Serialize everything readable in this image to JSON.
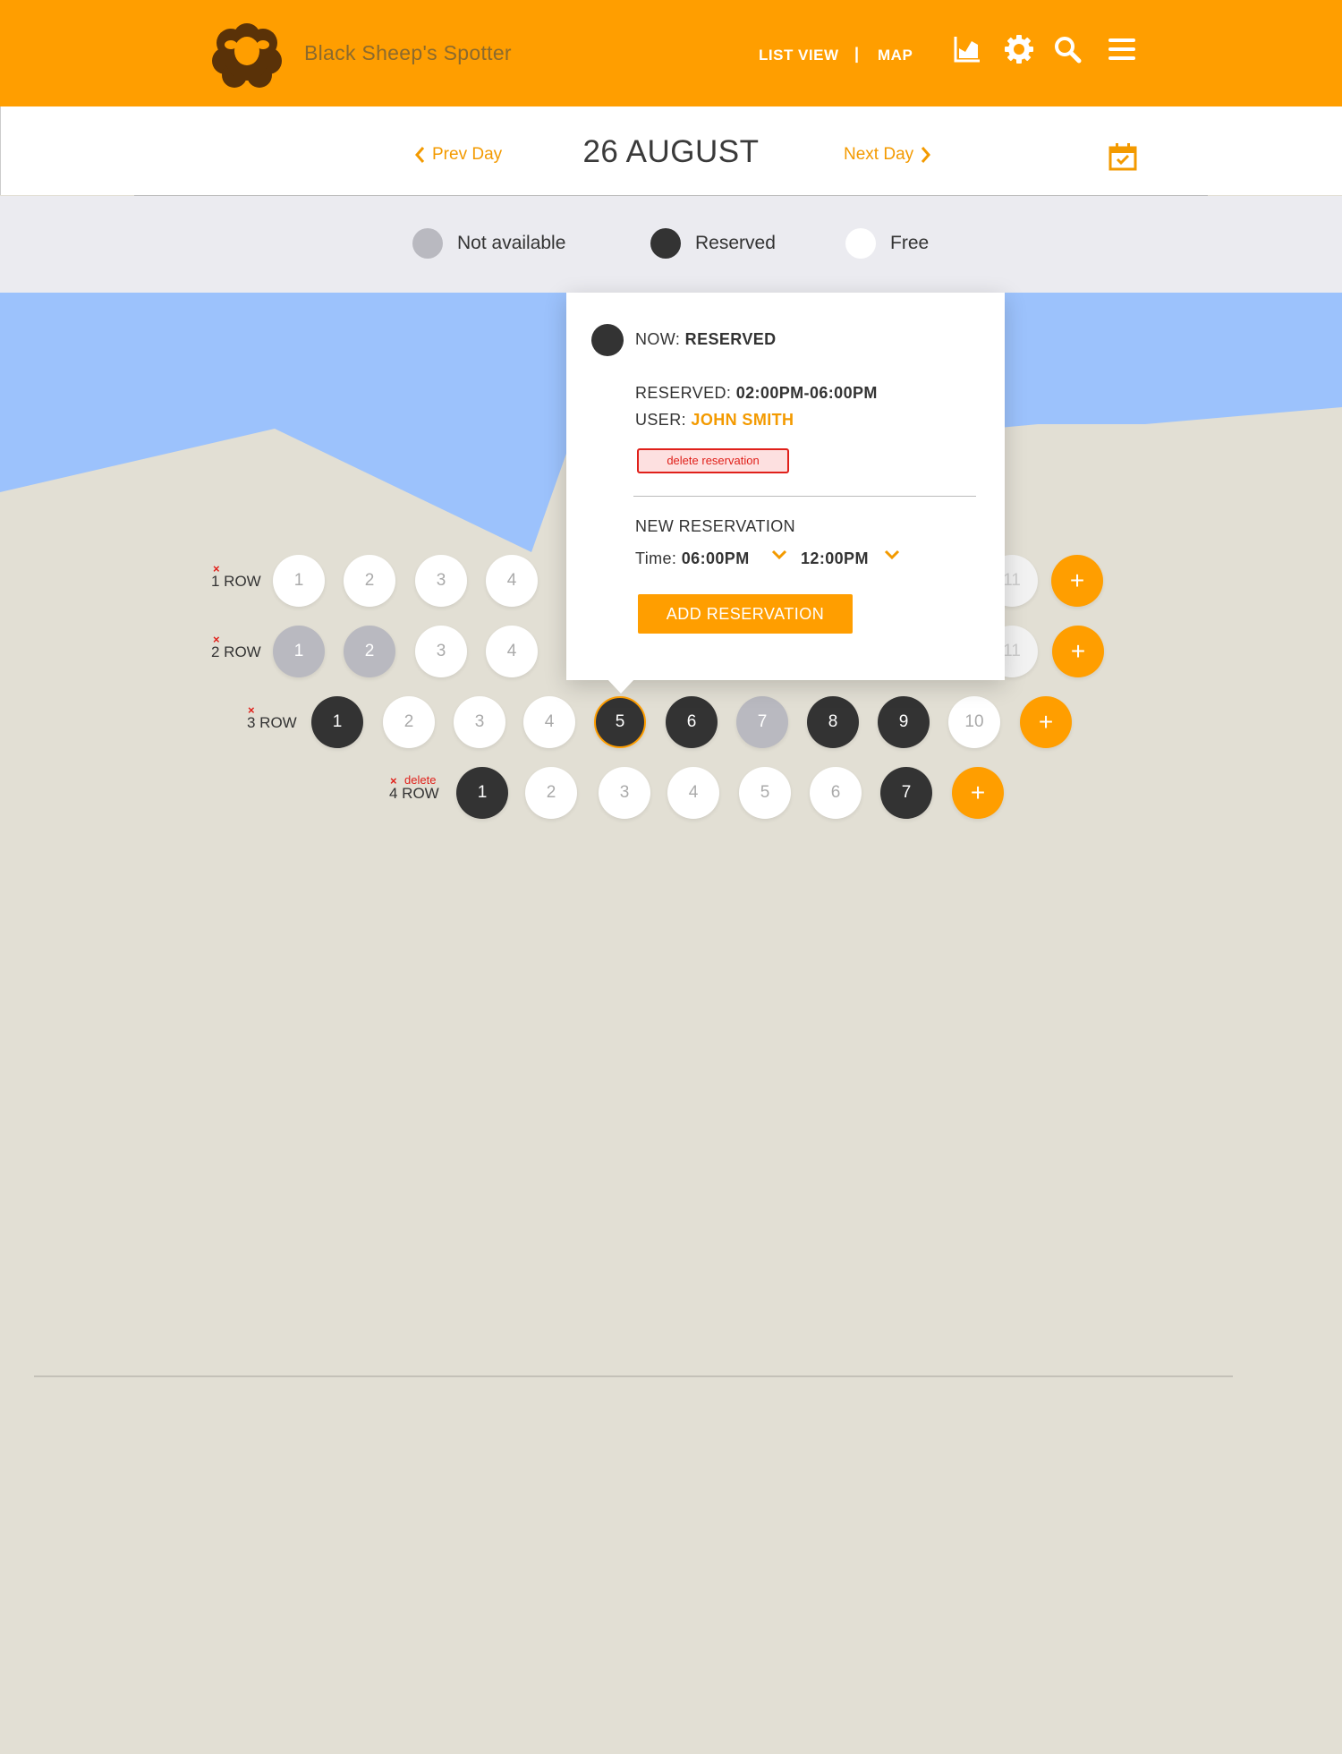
{
  "app": {
    "brand": "Black Sheep's Spotter",
    "logo_icon": "sheep-logo-icon",
    "colors": {
      "accent": "#ff9e00",
      "reserved": "#333333",
      "not_available": "#b9b9c0",
      "free": "#ffffff",
      "sky": "#9cc2fc",
      "sand": "#e2dfd4",
      "danger": "#e0201a"
    }
  },
  "header": {
    "list_view": "LIST VIEW",
    "separator": "|",
    "map": "MAP",
    "icons": [
      "chart-icon",
      "gear-icon",
      "search-icon",
      "menu-icon"
    ]
  },
  "datebar": {
    "prev_label": "Prev Day",
    "date": "26 AUGUST",
    "next_label": "Next Day",
    "calendar_icon": "calendar-check-icon"
  },
  "legend": {
    "not_available": "Not available",
    "reserved": "Reserved",
    "free": "Free"
  },
  "rows": [
    {
      "label": "1 ROW",
      "delete_mark": "×",
      "spots": [
        {
          "n": "1",
          "s": "free"
        },
        {
          "n": "2",
          "s": "free"
        },
        {
          "n": "3",
          "s": "free"
        },
        {
          "n": "4",
          "s": "free"
        },
        {
          "n": "11",
          "s": "faded"
        }
      ],
      "add": "+"
    },
    {
      "label": "2 ROW",
      "delete_mark": "×",
      "spots": [
        {
          "n": "1",
          "s": "na"
        },
        {
          "n": "2",
          "s": "na"
        },
        {
          "n": "3",
          "s": "free"
        },
        {
          "n": "4",
          "s": "free"
        },
        {
          "n": "11",
          "s": "faded"
        }
      ],
      "add": "+"
    },
    {
      "label": "3 ROW",
      "delete_mark": "×",
      "spots": [
        {
          "n": "1",
          "s": "res"
        },
        {
          "n": "2",
          "s": "free"
        },
        {
          "n": "3",
          "s": "free"
        },
        {
          "n": "4",
          "s": "free"
        },
        {
          "n": "5",
          "s": "res",
          "selected": true
        },
        {
          "n": "6",
          "s": "res"
        },
        {
          "n": "7",
          "s": "na"
        },
        {
          "n": "8",
          "s": "res"
        },
        {
          "n": "9",
          "s": "res"
        },
        {
          "n": "10",
          "s": "free"
        }
      ],
      "add": "+"
    },
    {
      "label": "4 ROW",
      "delete_mark": "×",
      "delete_text": "delete",
      "spots": [
        {
          "n": "1",
          "s": "res"
        },
        {
          "n": "2",
          "s": "free"
        },
        {
          "n": "3",
          "s": "free"
        },
        {
          "n": "4",
          "s": "free"
        },
        {
          "n": "5",
          "s": "free"
        },
        {
          "n": "6",
          "s": "free"
        },
        {
          "n": "7",
          "s": "res"
        }
      ],
      "add": "+"
    }
  ],
  "popup": {
    "now_label": "NOW:",
    "now_status": "RESERVED",
    "reserved_label": "RESERVED:",
    "reserved_time": "02:00PM-06:00PM",
    "user_label": "USER:",
    "user_name": "JOHN SMITH",
    "delete_button": "delete reservation",
    "new_title": "NEW RESERVATION",
    "time_label": "Time:",
    "time_from": "06:00PM",
    "time_to": "12:00PM",
    "add_button": "ADD RESERVATION"
  }
}
